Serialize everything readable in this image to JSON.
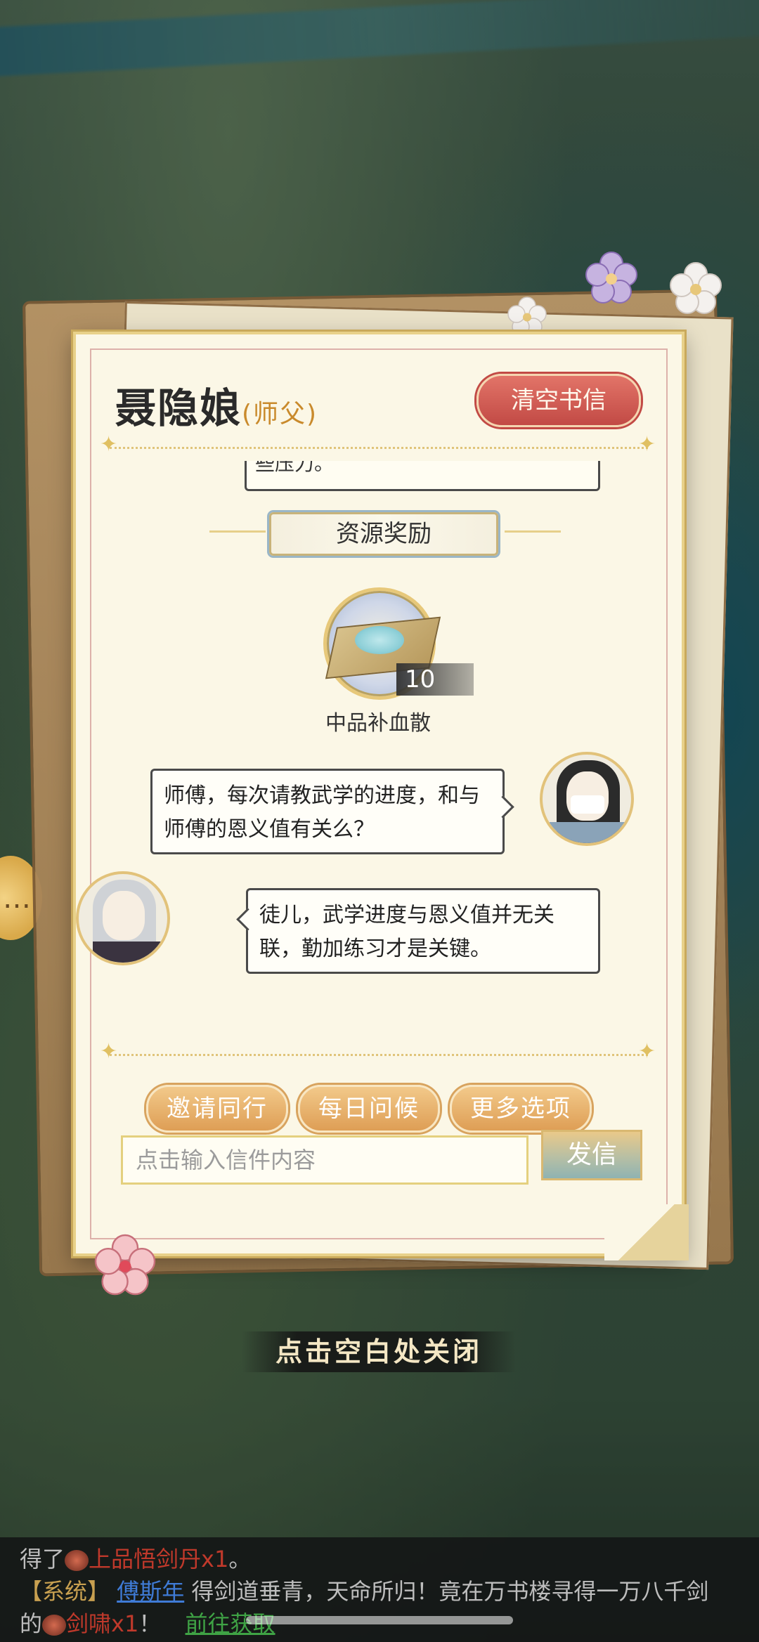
{
  "letter": {
    "title": "聂隐娘",
    "title_role": "(师父)",
    "clear_button": "清空书信",
    "prev_message_tail": "些压力。",
    "reward_header": "资源奖励",
    "reward_item": {
      "name": "中品补血散",
      "count": "10",
      "icon": "blood-powder-icon"
    },
    "messages": [
      {
        "from": "disciple",
        "text": "师傅，每次请教武学的进度，和与师傅的恩义值有关么？"
      },
      {
        "from": "master",
        "text": "徒儿，武学进度与恩义值并无关联，勤加练习才是关键。"
      }
    ],
    "actions": [
      "邀请同行",
      "每日问候",
      "更多选项"
    ],
    "input_placeholder": "点击输入信件内容",
    "send_button": "发信"
  },
  "close_hint": "点击空白处关闭",
  "chat": {
    "line1": {
      "prefix": "得了",
      "item": "上品悟剑丹x1",
      "suffix": "。"
    },
    "line2": {
      "tag": "【系统】",
      "player": "傅斯年",
      "text": "得剑道垂青，天命所归！竟在万书楼寻得一万八千剑"
    },
    "line3": {
      "prefix": "的",
      "item": "剑啸x1",
      "suffix": "！",
      "link": "前往获取"
    }
  },
  "colors": {
    "accent_red": "#c24a45",
    "gold": "#e0c062",
    "button_orange": "#de9e55"
  }
}
